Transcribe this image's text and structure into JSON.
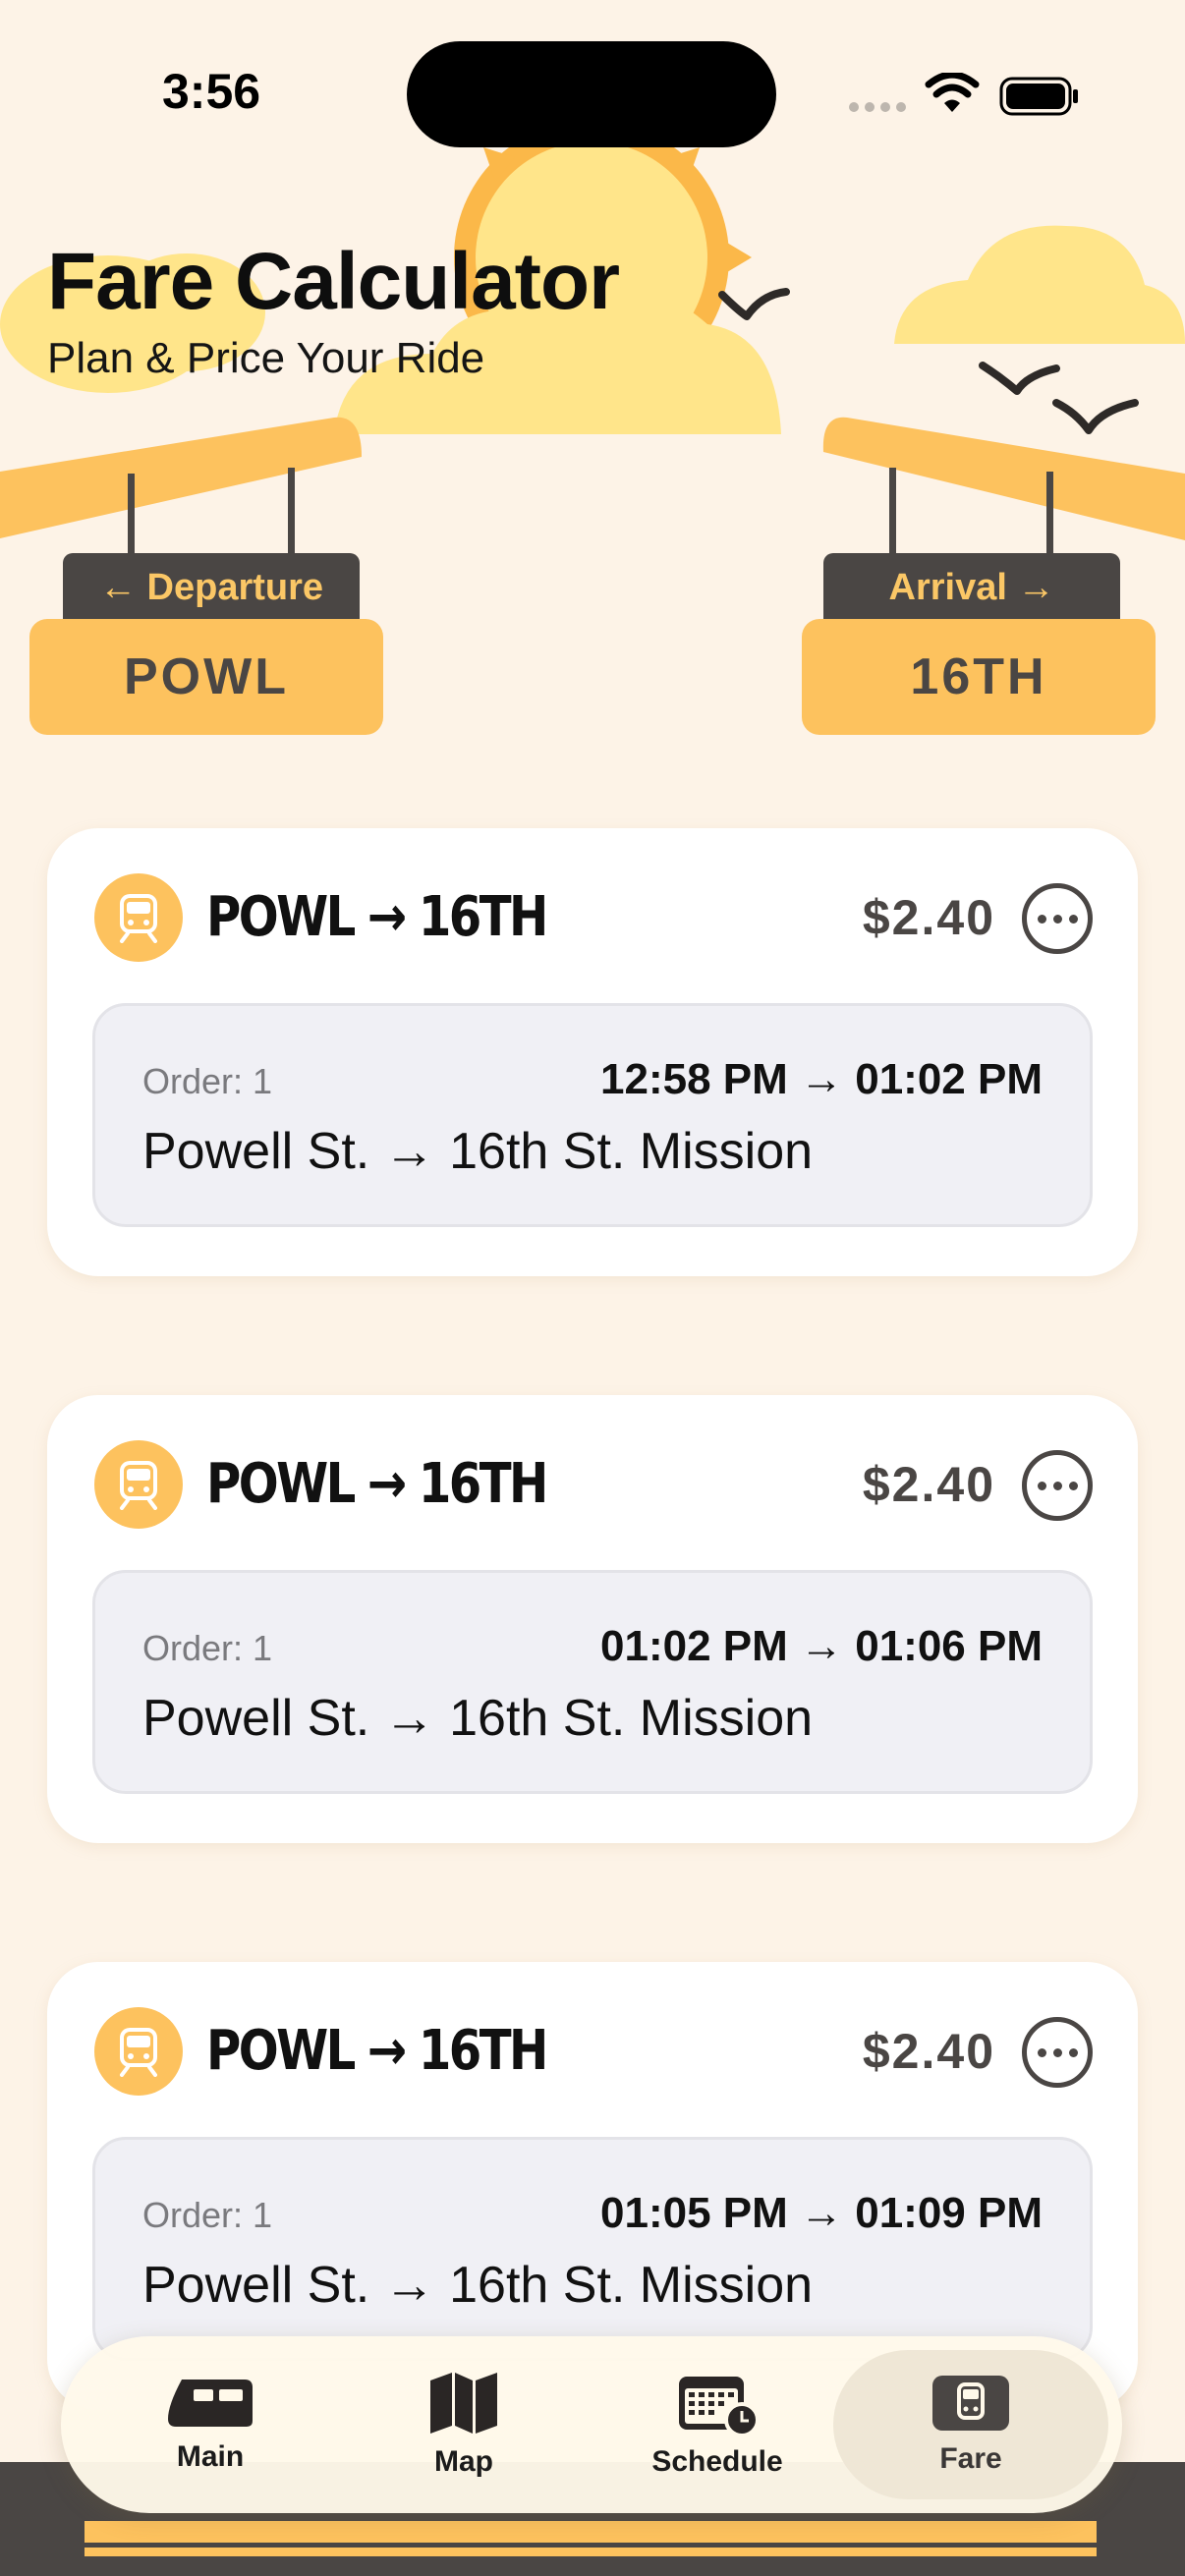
{
  "status_bar": {
    "time": "3:56"
  },
  "header": {
    "title": "Fare Calculator",
    "subtitle": "Plan & Price Your Ride"
  },
  "departure": {
    "label": "← Departure",
    "station": "POWL"
  },
  "arrival": {
    "label": "Arrival →",
    "station": "16TH"
  },
  "fares": [
    {
      "route": "POWL → 16TH",
      "price": "$2.40",
      "order": "Order: 1",
      "time": "12:58 PM → 01:02 PM",
      "stations": "Powell St. → 16th St. Mission"
    },
    {
      "route": "POWL → 16TH",
      "price": "$2.40",
      "order": "Order: 1",
      "time": "01:02 PM → 01:06 PM",
      "stations": "Powell St. → 16th St. Mission"
    },
    {
      "route": "POWL → 16TH",
      "price": "$2.40",
      "order": "Order: 1",
      "time": "01:05 PM → 01:09 PM",
      "stations": "Powell St. → 16th St. Mission"
    }
  ],
  "tab_bar": {
    "items": [
      {
        "label": "Main",
        "icon": "train-icon"
      },
      {
        "label": "Map",
        "icon": "map-icon"
      },
      {
        "label": "Schedule",
        "icon": "calendar-clock-icon"
      },
      {
        "label": "Fare",
        "icon": "tram-icon",
        "selected": true
      }
    ]
  },
  "colors": {
    "accent": "#FDC25E",
    "dark": "#4A4644",
    "background": "#FDF3E7"
  }
}
